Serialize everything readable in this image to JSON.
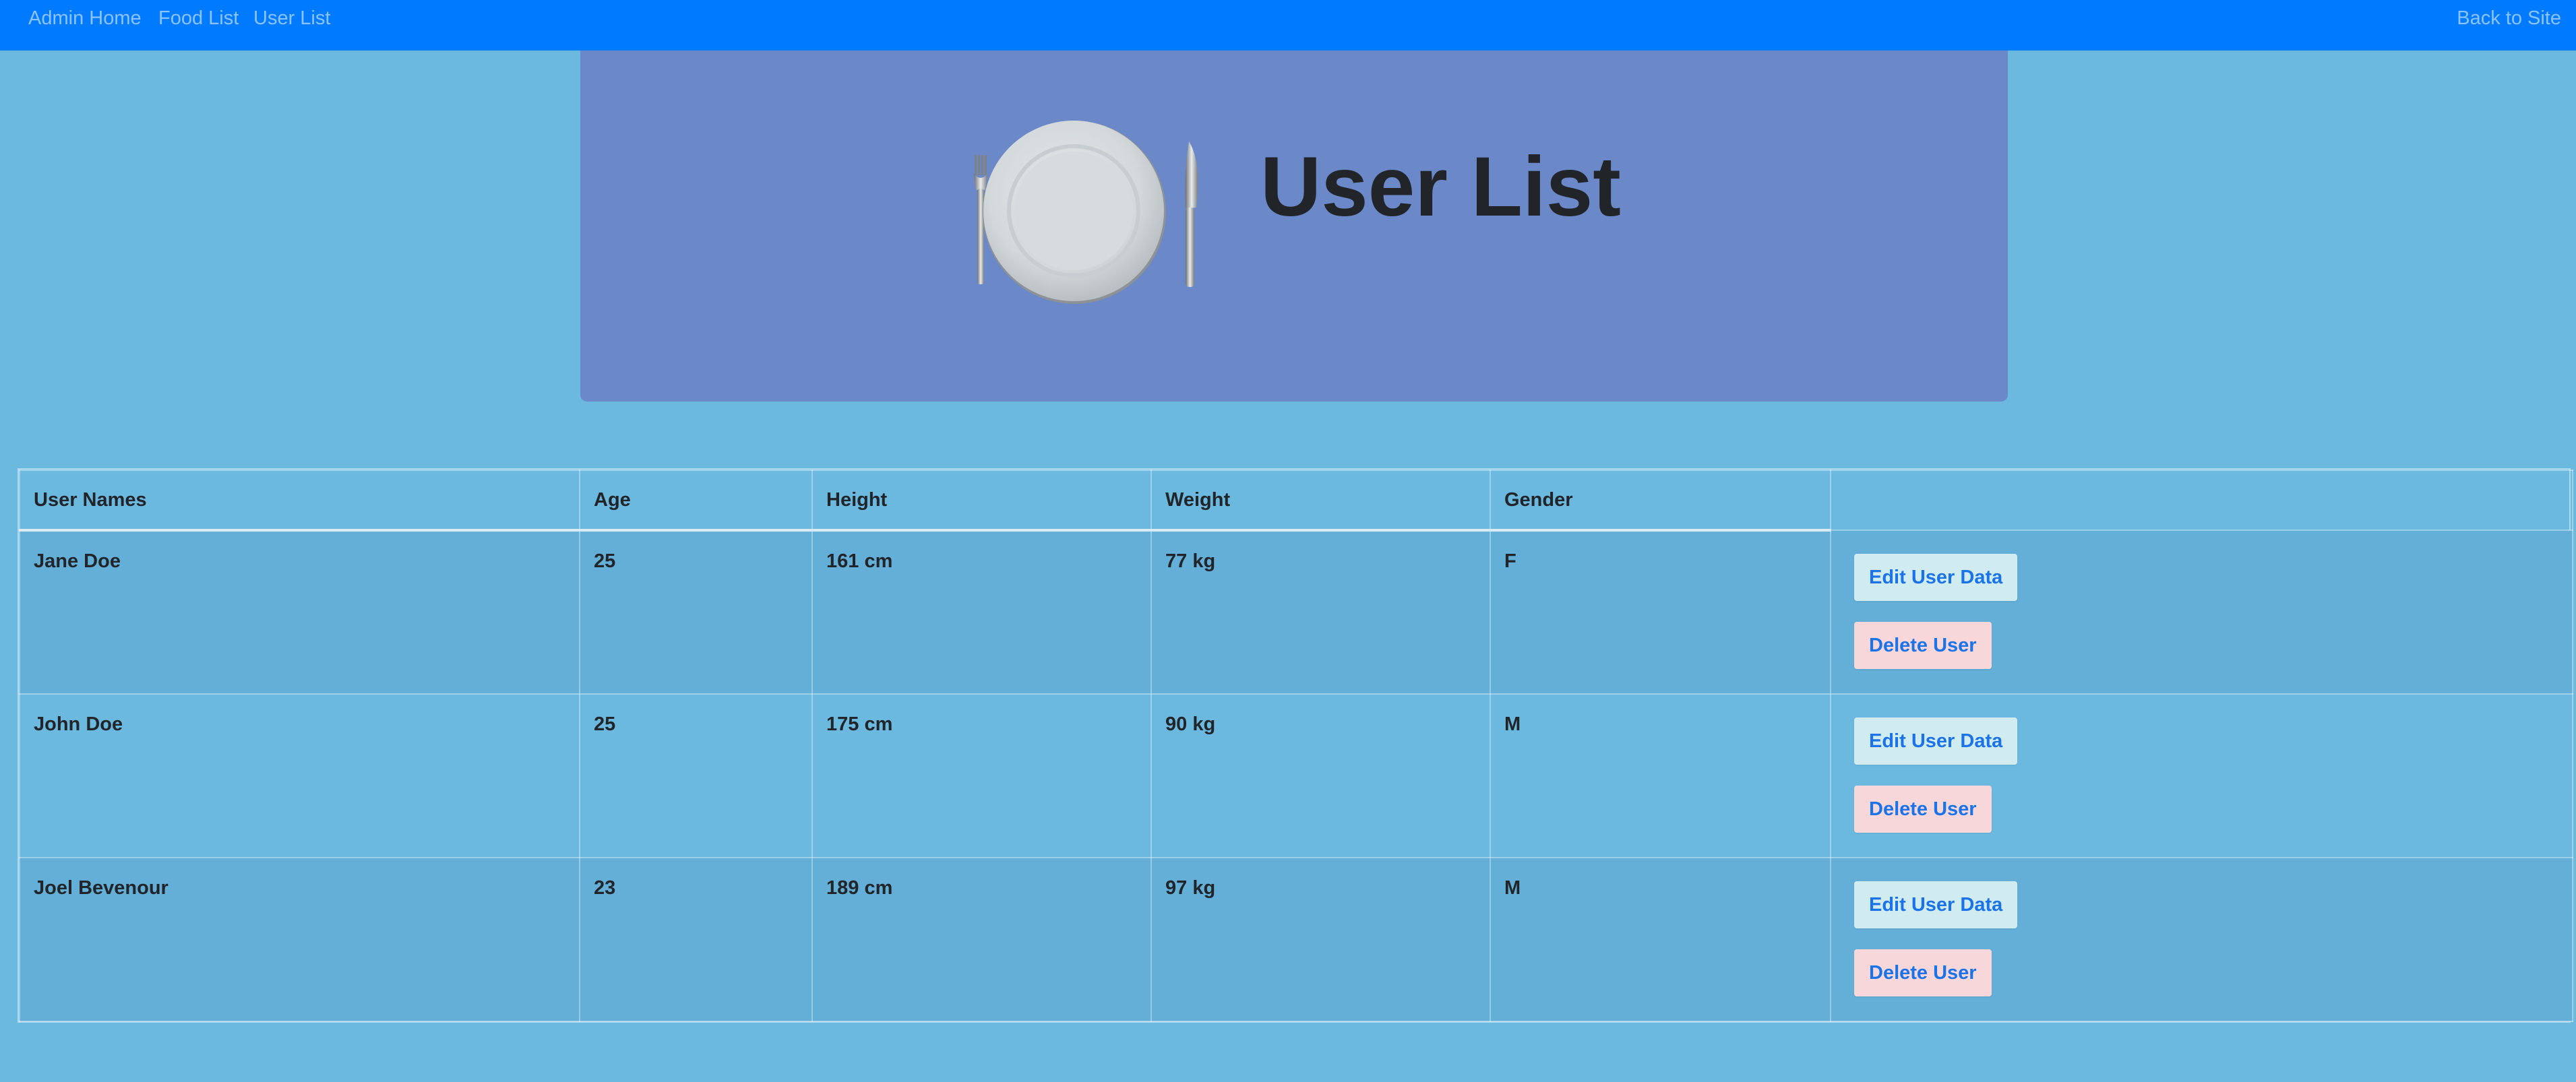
{
  "nav": {
    "admin_home": "Admin Home",
    "food_list": "Food List",
    "user_list": "User List",
    "back_to_site": "Back to Site"
  },
  "header": {
    "title": "User List",
    "logo_icon": "plate-fork-knife-icon"
  },
  "table": {
    "columns": [
      "User Names",
      "Age",
      "Height",
      "Weight",
      "Gender"
    ],
    "rows": [
      {
        "name": "Jane Doe",
        "age": "25",
        "height": "161 cm",
        "weight": "77 kg",
        "gender": "F",
        "edit_label": "Edit User Data",
        "delete_label": "Delete User"
      },
      {
        "name": "John Doe",
        "age": "25",
        "height": "175 cm",
        "weight": "90 kg",
        "gender": "M",
        "edit_label": "Edit User Data",
        "delete_label": "Delete User"
      },
      {
        "name": "Joel Bevenour",
        "age": "23",
        "height": "189 cm",
        "weight": "97 kg",
        "gender": "M",
        "edit_label": "Edit User Data",
        "delete_label": "Delete User"
      }
    ]
  },
  "colors": {
    "navbar": "#007bff",
    "page_background": "#6bb9df",
    "header_background": "#6b89c9",
    "edit_button_bg": "#d1ecf1",
    "delete_button_bg": "#f8d7da",
    "button_text": "#1a73e8"
  }
}
